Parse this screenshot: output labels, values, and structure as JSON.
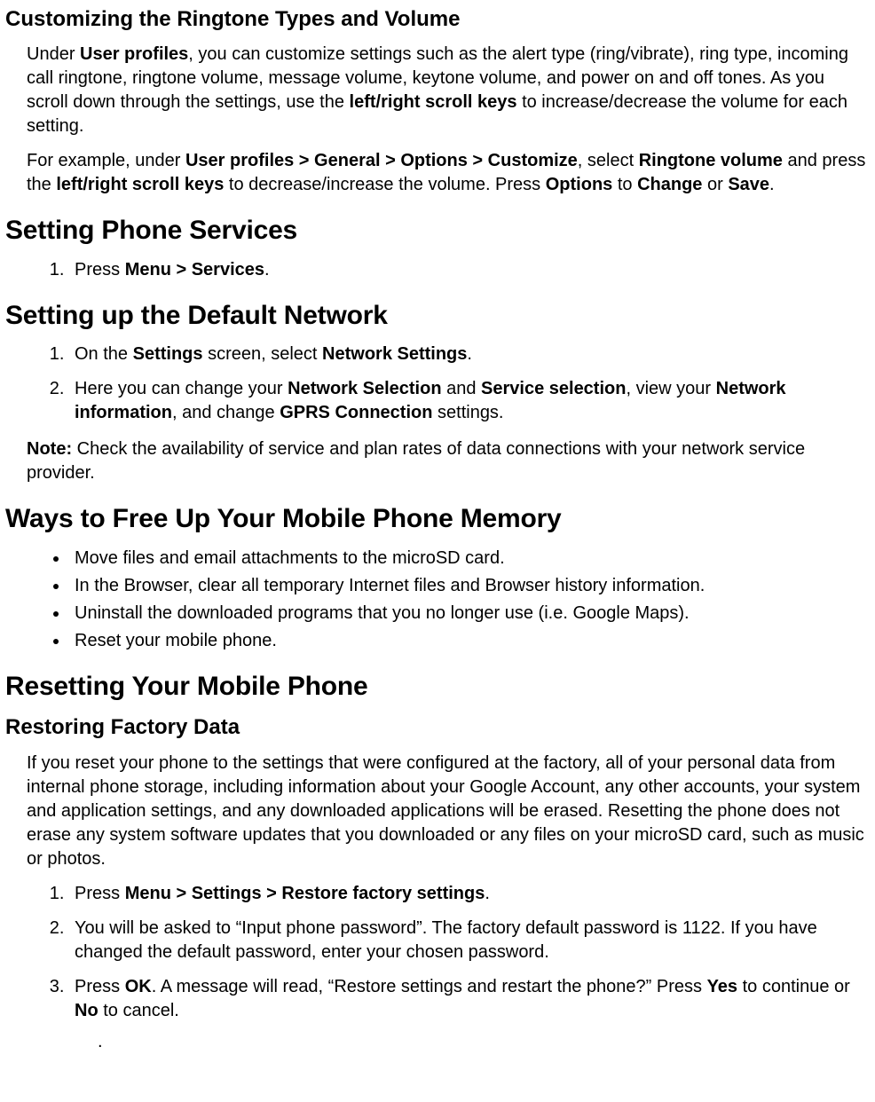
{
  "sections": {
    "ringtone": {
      "heading": "Customizing the  Ringtone Types and Volume",
      "p1_a": "Under ",
      "p1_b_userprofiles": "User profiles",
      "p1_c": ", you can customize settings such as the alert type (ring/vibrate), ring type, incoming call ringtone, ringtone volume, message volume, keytone volume, and power on and off tones. As you scroll down through the settings, use the ",
      "p1_d_keys": "left/right scroll keys",
      "p1_e": " to increase/decrease the volume for each setting.",
      "p2_a": "For example, under ",
      "p2_b_path": "User profiles > General > Options > Customize",
      "p2_c": ", select ",
      "p2_d_rv": "Ringtone volume",
      "p2_e": " and press the ",
      "p2_f_keys": "left/right scroll keys",
      "p2_g": " to decrease/increase the volume. Press ",
      "p2_h_options": "Options",
      "p2_i": " to ",
      "p2_j_change": "Change",
      "p2_k": " or ",
      "p2_l_save": "Save",
      "p2_m": "."
    },
    "services": {
      "heading": "Setting Phone Services",
      "li1_a": "Press ",
      "li1_b": "Menu > Services",
      "li1_c": "."
    },
    "network": {
      "heading": "Setting up the  Default Network",
      "li1_a": "On the ",
      "li1_b_settings": "Settings",
      "li1_c": "  screen, select ",
      "li1_d_ns": "Network Settings",
      "li1_e": ".",
      "li2_a": "Here you can change your ",
      "li2_b_nsel": "Network Selection",
      "li2_c": " and ",
      "li2_d_ssel": "Service selection",
      "li2_e": ", view your ",
      "li2_f_ninfo": "Network information",
      "li2_g": ", and change ",
      "li2_h_gprs": "GPRS Connection",
      "li2_i": " settings.",
      "note_a": "Note:",
      "note_b": " Check the availability of service and plan rates of data connections with  your network service provider."
    },
    "memory": {
      "heading": "Ways to Free Up Your Mobile Phone Memory",
      "li1": "Move files and email attachments to the microSD card.",
      "li2": "In the Browser, clear all temporary Internet files and Browser history information.",
      "li3": "Uninstall the downloaded programs that you no longer use (i.e. Google Maps).",
      "li4": "Reset your mobile phone."
    },
    "reset": {
      "heading": "Resetting Your Mobile  Phone",
      "subheading": "Restoring Factory Data",
      "p1": "If you reset your phone to the settings that were configured at the factory, all of your personal data from internal phone storage, including information about your Google Account, any other accounts, your system and application settings, and any downloaded applications will be erased. Resetting the phone does not erase any system software updates that you downloaded or any files on your microSD card, such as music or photos.",
      "li1_a": "Press ",
      "li1_b": "Menu > Settings > Restore factory settings",
      "li1_c": ".",
      "li2": "You will be asked to “Input phone password”. The factory default password is 1122. If you have changed the default password, enter your chosen password.",
      "li3_a": "Press ",
      "li3_b_ok": "OK",
      "li3_c": ". A message will read, “Restore settings and restart the phone?” Press ",
      "li3_d_yes": "Yes",
      "li3_e": " to continue or ",
      "li3_f_no": "No",
      "li3_g": " to cancel.",
      "dot": "."
    }
  }
}
